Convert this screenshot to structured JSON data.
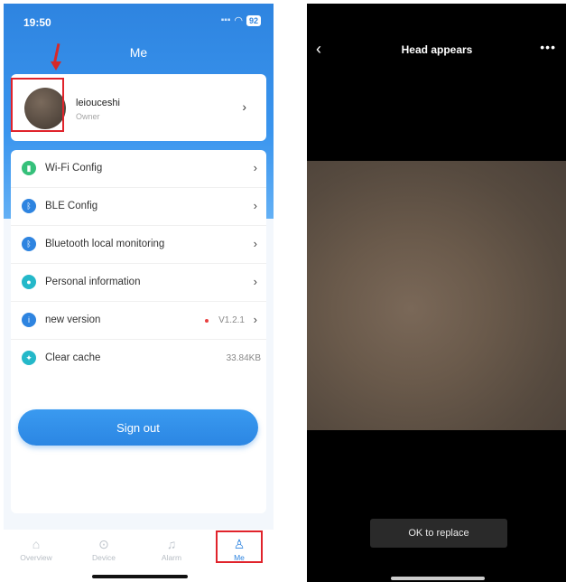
{
  "left_screen": {
    "status": {
      "time": "19:50",
      "battery": "92"
    },
    "header": {
      "title": "Me"
    },
    "profile": {
      "name": "leiouceshi",
      "role": "Owner"
    },
    "menu": [
      {
        "label": "Wi-Fi Config",
        "icon": "wifi-config-icon",
        "color": "#35c07a"
      },
      {
        "label": "BLE Config",
        "icon": "ble-icon",
        "color": "#2e84e0"
      },
      {
        "label": "Bluetooth local monitoring",
        "icon": "bluetooth-icon",
        "color": "#2e84e0"
      },
      {
        "label": "Personal information",
        "icon": "person-icon",
        "color": "#24b8c9"
      },
      {
        "label": "new version",
        "icon": "info-icon",
        "color": "#2e84e0",
        "value": "V1.2.1"
      },
      {
        "label": "Clear cache",
        "icon": "broom-icon",
        "color": "#24b8c9",
        "value": "33.84KB"
      }
    ],
    "signout_label": "Sign out",
    "tabs": [
      {
        "label": "Overview",
        "icon": "overview-icon"
      },
      {
        "label": "Device",
        "icon": "device-icon"
      },
      {
        "label": "Alarm",
        "icon": "bell-icon"
      },
      {
        "label": "Me",
        "icon": "person-icon",
        "active": true
      }
    ]
  },
  "right_screen": {
    "title": "Head appears",
    "ok_button": "OK to replace"
  },
  "colors": {
    "accent": "#2e84e0",
    "highlight": "#e0232b"
  }
}
